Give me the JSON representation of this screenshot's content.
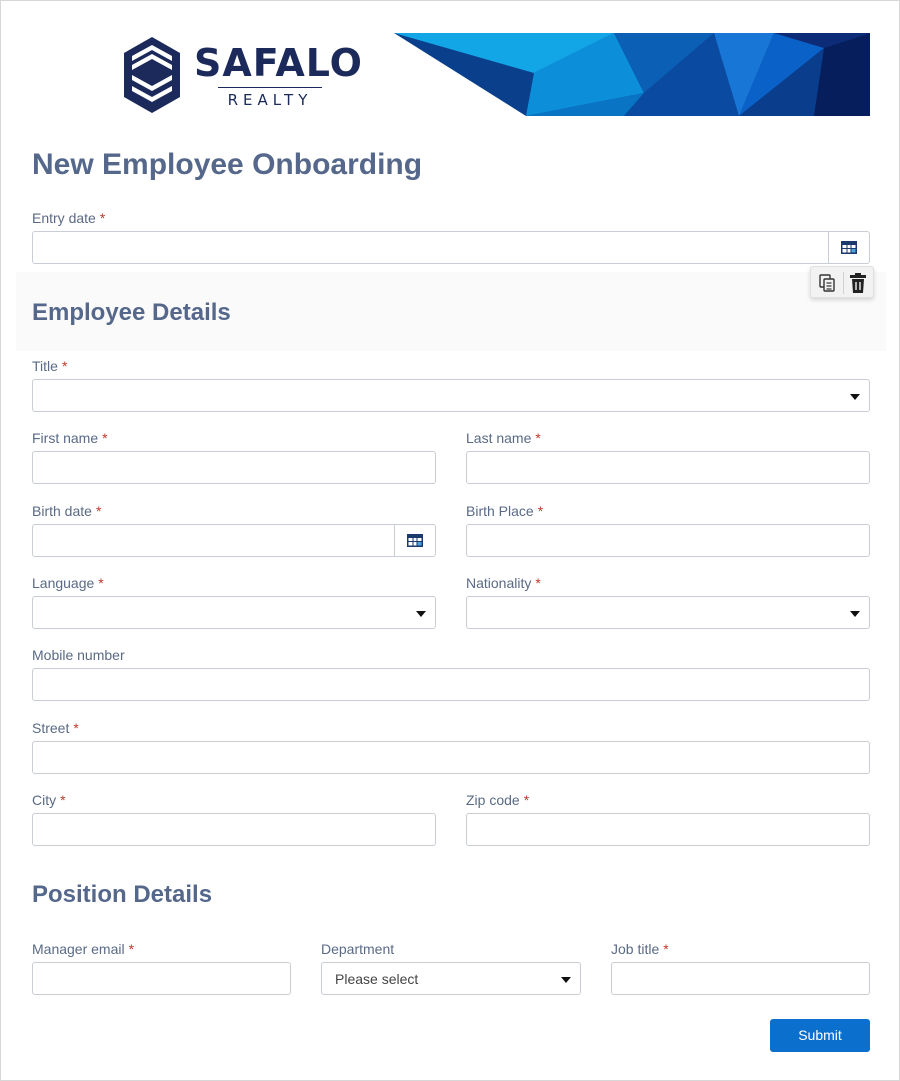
{
  "logo": {
    "name": "SAFALO",
    "sub": "REALTY"
  },
  "form": {
    "title": "New Employee Onboarding",
    "submit_label": "Submit"
  },
  "fields": {
    "entry_date": {
      "label": "Entry date",
      "required": "*",
      "value": ""
    },
    "title": {
      "label": "Title",
      "required": "*",
      "value": ""
    },
    "first_name": {
      "label": "First name",
      "required": "*",
      "value": ""
    },
    "last_name": {
      "label": "Last name",
      "required": "*",
      "value": ""
    },
    "birth_date": {
      "label": "Birth date",
      "required": "*",
      "value": ""
    },
    "birth_place": {
      "label": "Birth Place",
      "required": "*",
      "value": ""
    },
    "language": {
      "label": "Language",
      "required": "*",
      "value": ""
    },
    "nationality": {
      "label": "Nationality",
      "required": "*",
      "value": ""
    },
    "mobile_number": {
      "label": "Mobile number",
      "value": ""
    },
    "street": {
      "label": "Street",
      "required": "*",
      "value": ""
    },
    "city": {
      "label": "City",
      "required": "*",
      "value": ""
    },
    "zip_code": {
      "label": "Zip code",
      "required": "*",
      "value": ""
    },
    "manager_email": {
      "label": "Manager email",
      "required": "*",
      "value": ""
    },
    "department": {
      "label": "Department",
      "value": "Please select"
    },
    "job_title": {
      "label": "Job title",
      "required": "*",
      "value": ""
    }
  },
  "sections": {
    "employee": "Employee Details",
    "position": "Position Details"
  },
  "icons": {
    "calendar": "calendar-icon",
    "dropdown": "chevron-down-icon",
    "copy": "copy-icon",
    "delete": "trash-icon"
  },
  "colors": {
    "heading": "#55688b",
    "primary_button": "#0b6fcd",
    "required_marker": "#c0392b",
    "brand_navy": "#1b2a5a"
  }
}
